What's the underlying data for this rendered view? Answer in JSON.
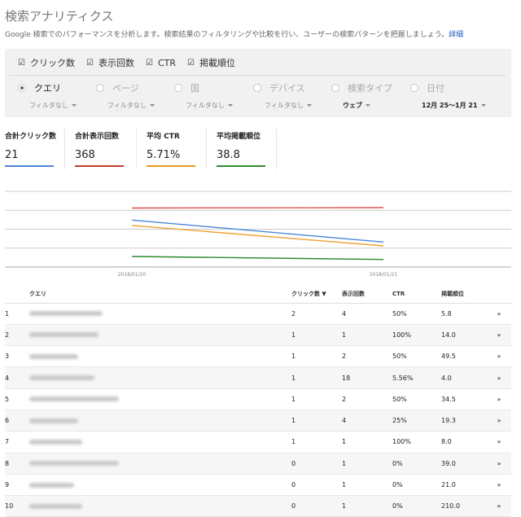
{
  "header": {
    "title": "検索アナリティクス",
    "description": "Google 検索でのパフォーマンスを分析します。検索結果のフィルタリングや比較を行い、ユーザーの検索パターンを把握しましょう。",
    "details_link": "詳細"
  },
  "metrics": [
    {
      "label": "クリック数",
      "checked": true
    },
    {
      "label": "表示回数",
      "checked": true
    },
    {
      "label": "CTR",
      "checked": true
    },
    {
      "label": "掲載順位",
      "checked": true
    }
  ],
  "dimensions": [
    {
      "label": "クエリ",
      "sub": "フィルタなし",
      "selected": true
    },
    {
      "label": "ページ",
      "sub": "フィルタなし",
      "selected": false
    },
    {
      "label": "国",
      "sub": "フィルタなし",
      "selected": false
    },
    {
      "label": "デバイス",
      "sub": "フィルタなし",
      "selected": false
    },
    {
      "label": "検索タイプ",
      "sub": "ウェブ",
      "selected": false
    },
    {
      "label": "日付",
      "sub": "12月 25～1月 21",
      "selected": false
    }
  ],
  "summary": [
    {
      "title": "合計クリック数",
      "value": "21",
      "color": "#4a86d8"
    },
    {
      "title": "合計表示回数",
      "value": "368",
      "color": "#c0392b"
    },
    {
      "title": "平均 CTR",
      "value": "5.71%",
      "color": "#e69a1a"
    },
    {
      "title": "平均掲載順位",
      "value": "38.8",
      "color": "#2e8b2e"
    }
  ],
  "chart_data": {
    "type": "line",
    "x": [
      "2018/01/20",
      "2018/01/21"
    ],
    "series": [
      {
        "values": [
          22,
          21.5
        ],
        "color": "#d9534f"
      },
      {
        "values": [
          45,
          72
        ],
        "color": "#f0a030"
      },
      {
        "values": [
          38,
          67
        ],
        "color": "#4a86d8"
      },
      {
        "values": [
          86,
          90
        ],
        "color": "#2e8b2e"
      }
    ],
    "ylim": [
      0,
      100
    ],
    "grid": true
  },
  "table": {
    "columns": {
      "idx": "",
      "query": "クエリ",
      "clicks": "クリック数 ▼",
      "impressions": "表示回数",
      "ctr": "CTR",
      "position": "掲載順位"
    },
    "rows": [
      {
        "idx": "1",
        "clicks": "2",
        "impressions": "4",
        "ctr": "50%",
        "position": "5.8",
        "blur": 90
      },
      {
        "idx": "2",
        "clicks": "1",
        "impressions": "1",
        "ctr": "100%",
        "position": "14.0",
        "blur": 85
      },
      {
        "idx": "3",
        "clicks": "1",
        "impressions": "2",
        "ctr": "50%",
        "position": "49.5",
        "blur": 60
      },
      {
        "idx": "4",
        "clicks": "1",
        "impressions": "18",
        "ctr": "5.56%",
        "position": "4.0",
        "blur": 80
      },
      {
        "idx": "5",
        "clicks": "1",
        "impressions": "2",
        "ctr": "50%",
        "position": "34.5",
        "blur": 110
      },
      {
        "idx": "6",
        "clicks": "1",
        "impressions": "4",
        "ctr": "25%",
        "position": "19.3",
        "blur": 60
      },
      {
        "idx": "7",
        "clicks": "1",
        "impressions": "1",
        "ctr": "100%",
        "position": "8.0",
        "blur": 65
      },
      {
        "idx": "8",
        "clicks": "0",
        "impressions": "1",
        "ctr": "0%",
        "position": "39.0",
        "blur": 110
      },
      {
        "idx": "9",
        "clicks": "0",
        "impressions": "1",
        "ctr": "0%",
        "position": "21.0",
        "blur": 55
      },
      {
        "idx": "10",
        "clicks": "0",
        "impressions": "1",
        "ctr": "0%",
        "position": "210.0",
        "blur": 65
      }
    ],
    "row_action_icon": "double-chevron-right-icon"
  }
}
